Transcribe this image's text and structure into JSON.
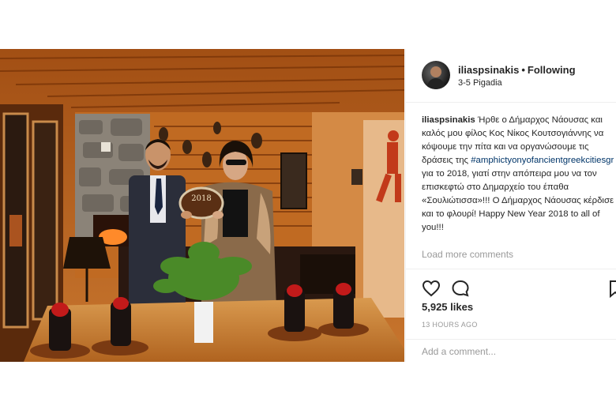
{
  "post": {
    "username": "iliaspsinakis",
    "dot": "•",
    "follow_label": "Following",
    "location": "3-5 Pigadia",
    "caption": {
      "user": "iliaspsinakis",
      "text1": " Ήρθε ο Δήμαρχος Νάουσας και καλός μου φίλος Κος Νίκος Κουτσογιάννης να κόψουμε την πίτα και να οργανώσουμε τις δράσεις της ",
      "hashtag": "#amphictyonyofancientgreekcitiesgr",
      "text2": " για το 2018, γιατί στην απόπειρα μου να τον επισκεφτώ στο Δημαρχείο του έπαθα «Σουλιώτισσα»!!! Ο Δήμαρχος Νάουσας κέρδισε και το φλουρί! Happy New Year 2018 to all of you!!!"
    },
    "load_more": "Load more comments",
    "likes": "5,925 likes",
    "time": "13 HOURS AGO",
    "comment_placeholder": "Add a comment...",
    "cake_text": "2018",
    "colors": {
      "link": "#003569",
      "muted": "#999999",
      "text": "#262626",
      "wood": "#b8651f"
    },
    "icons": [
      "heart-icon",
      "comment-icon",
      "bookmark-icon"
    ]
  }
}
